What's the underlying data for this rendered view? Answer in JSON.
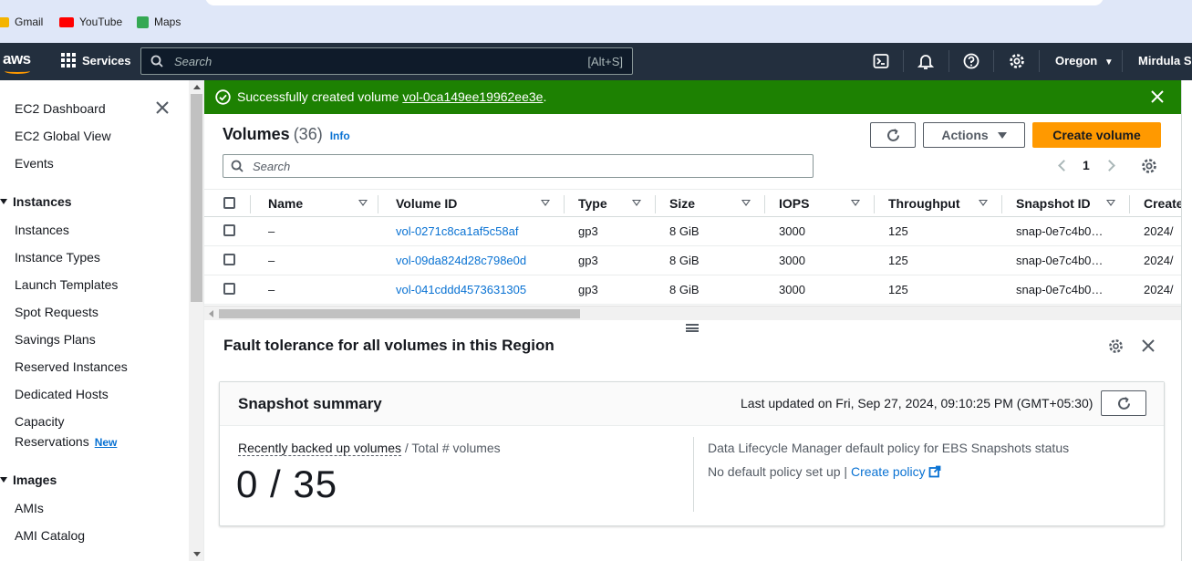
{
  "bookmarks": [
    {
      "label": "Gmail",
      "color": "#f4b400"
    },
    {
      "label": "YouTube",
      "color": "#ff0000"
    },
    {
      "label": "Maps",
      "color": "#34a853"
    }
  ],
  "topnav": {
    "logo": "aws",
    "services": "Services",
    "search_placeholder": "Search",
    "search_shortcut": "[Alt+S]",
    "region": "Oregon",
    "user": "Mirdula Sre"
  },
  "sidebar": {
    "items_top": [
      "EC2 Dashboard",
      "EC2 Global View",
      "Events"
    ],
    "instances_header": "Instances",
    "instances_items": [
      "Instances",
      "Instance Types",
      "Launch Templates",
      "Spot Requests",
      "Savings Plans",
      "Reserved Instances",
      "Dedicated Hosts"
    ],
    "capacity_line1": "Capacity",
    "capacity_line2": "Reservations",
    "new_badge": "New",
    "images_header": "Images",
    "images_items": [
      "AMIs",
      "AMI Catalog"
    ]
  },
  "flash": {
    "prefix": "Successfully created volume ",
    "volume_id": "vol-0ca149ee19962ee3e",
    "suffix": ".",
    "color": "#1d8102"
  },
  "volumes": {
    "title": "Volumes",
    "count": "(36)",
    "info": "Info",
    "actions": "Actions",
    "create": "Create volume",
    "search_placeholder": "Search",
    "page": "1",
    "columns": [
      "Name",
      "Volume ID",
      "Type",
      "Size",
      "IOPS",
      "Throughput",
      "Snapshot ID",
      "Create"
    ],
    "rows": [
      {
        "name": "–",
        "id": "vol-0271c8ca1af5c58af",
        "type": "gp3",
        "size": "8 GiB",
        "iops": "3000",
        "throughput": "125",
        "snapshot": "snap-0e7c4b0…",
        "created": "2024/"
      },
      {
        "name": "–",
        "id": "vol-09da824d28c798e0d",
        "type": "gp3",
        "size": "8 GiB",
        "iops": "3000",
        "throughput": "125",
        "snapshot": "snap-0e7c4b0…",
        "created": "2024/"
      },
      {
        "name": "–",
        "id": "vol-041cddd4573631305",
        "type": "gp3",
        "size": "8 GiB",
        "iops": "3000",
        "throughput": "125",
        "snapshot": "snap-0e7c4b0…",
        "created": "2024/"
      }
    ]
  },
  "fault": {
    "title": "Fault tolerance for all volumes in this Region"
  },
  "snapshot_summary": {
    "title": "Snapshot summary",
    "last_updated": "Last updated on Fri, Sep 27, 2024, 09:10:25 PM (GMT+05:30)",
    "metric_label_link": "Recently backed up volumes",
    "metric_label_rest": " / Total # volumes",
    "metric_value": "0 / 35",
    "dlm_header": "Data Lifecycle Manager default policy for EBS Snapshots status",
    "dlm_status": "No default policy set up | ",
    "dlm_link": "Create policy"
  }
}
